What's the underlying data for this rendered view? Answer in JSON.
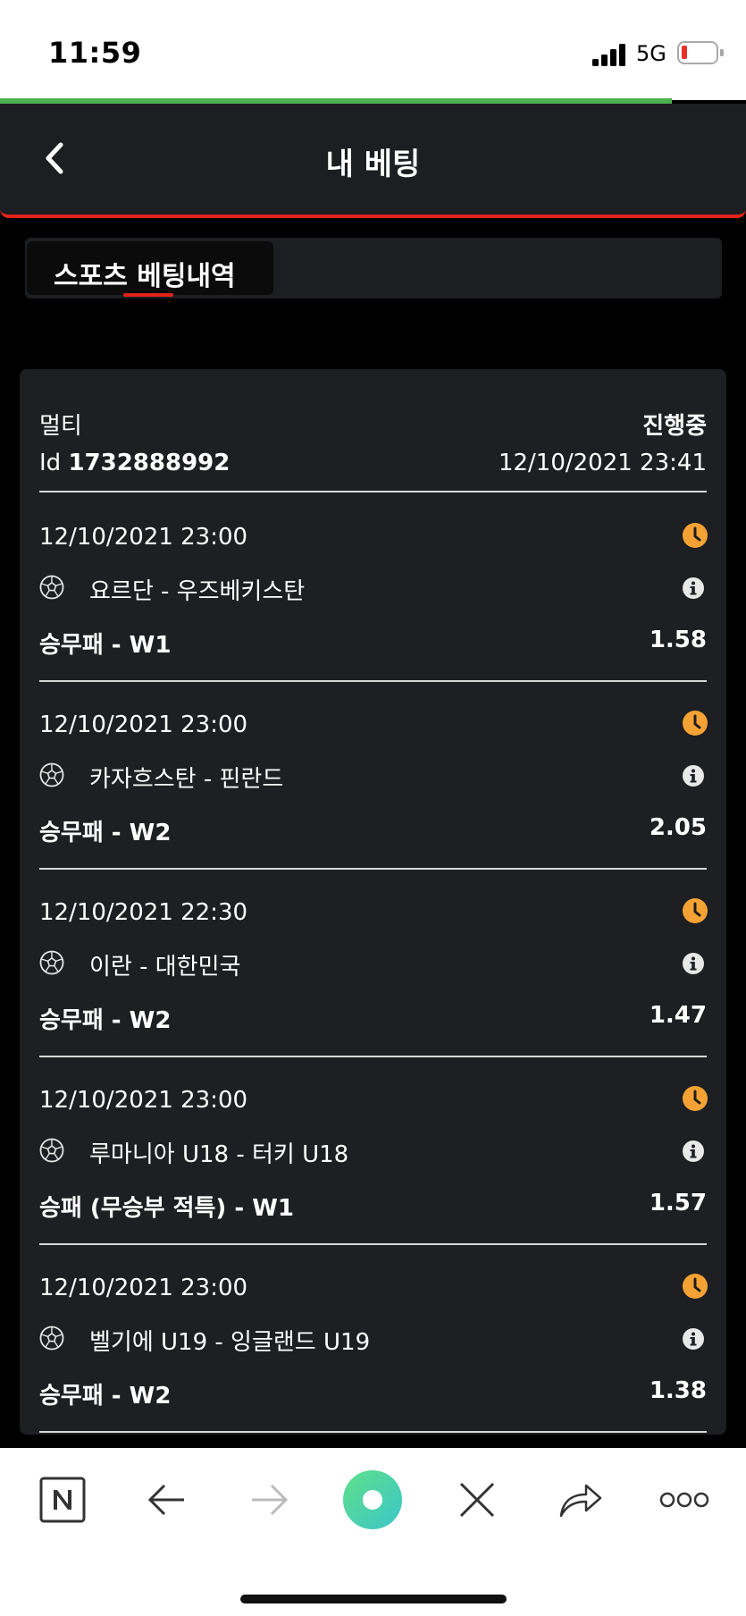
{
  "status_bar": {
    "time": "11:59",
    "network": "5G",
    "battery_color": "#e8302a"
  },
  "page_load_progress": 0.9,
  "header": {
    "title": "내 베팅",
    "back_icon": "chevron-left-icon",
    "accent_color": "#e2231a"
  },
  "tabs": [
    {
      "label": "스포츠 베팅내역",
      "active": true
    }
  ],
  "bet": {
    "type": "멀티",
    "status": "진행중",
    "id_prefix": "Id",
    "id": "1732888992",
    "placed_at": "12/10/2021 23:41",
    "events": [
      {
        "time": "12/10/2021 23:00",
        "teams": "요르단 - 우즈베키스탄",
        "market": "승무패 - W1",
        "odds": "1.58"
      },
      {
        "time": "12/10/2021 23:00",
        "teams": "카자흐스탄 - 핀란드",
        "market": "승무패 - W2",
        "odds": "2.05"
      },
      {
        "time": "12/10/2021 22:30",
        "teams": "이란 - 대한민국",
        "market": "승무패 - W2",
        "odds": "1.47"
      },
      {
        "time": "12/10/2021 23:00",
        "teams": "루마니아 U18 - 터키 U18",
        "market": "승패 (무승부 적특) - W1",
        "odds": "1.57"
      },
      {
        "time": "12/10/2021 23:00",
        "teams": "벨기에 U19 - 잉글랜드 U19",
        "market": "승무패 - W2",
        "odds": "1.38"
      }
    ],
    "pending_icon": "clock-icon",
    "pending_color": "#f5a234",
    "sport_icon": "soccer-ball-icon",
    "info_icon": "info-icon"
  },
  "browser_toolbar": {
    "buttons": [
      "naver-n-icon",
      "back-arrow-icon",
      "forward-arrow-icon",
      "green-dot-icon",
      "close-icon",
      "share-icon",
      "more-icon"
    ]
  }
}
